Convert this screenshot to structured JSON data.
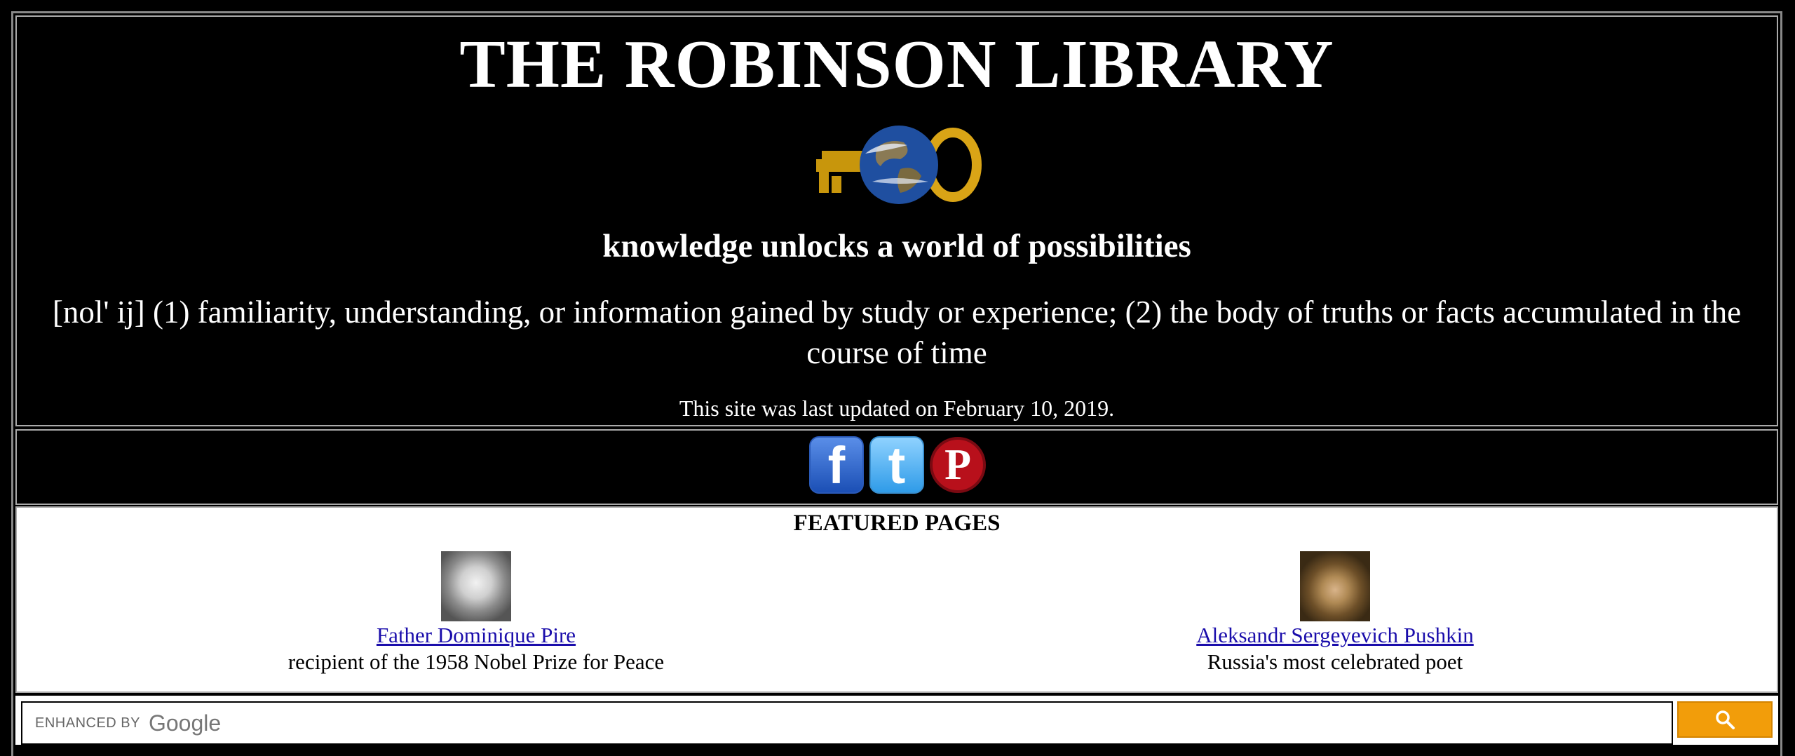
{
  "header": {
    "title": "THE ROBINSON LIBRARY",
    "tagline": "knowledge unlocks a world of possibilities",
    "definition": "[nol' ij] (1) familiarity, understanding, or information gained by study or experience; (2) the body of truths or facts accumulated in the course of time",
    "updated": "This site was last updated on February 10, 2019."
  },
  "social": [
    {
      "icon": "facebook-icon",
      "glyph": "f"
    },
    {
      "icon": "twitter-icon",
      "glyph": "t"
    },
    {
      "icon": "pinterest-icon",
      "glyph": "P"
    }
  ],
  "featured": {
    "title": "FEATURED PAGES",
    "items": [
      {
        "link": "Father Dominique Pire",
        "desc": "recipient of the 1958 Nobel Prize for Peace"
      },
      {
        "link": "Aleksandr Sergeyevich Pushkin",
        "desc": "Russia's most celebrated poet"
      }
    ]
  },
  "search": {
    "enhanced_by": "ENHANCED BY",
    "brand": "Google"
  },
  "colors": {
    "background": "#000000",
    "link": "#1a0dab",
    "search_button": "#f29d0a"
  }
}
